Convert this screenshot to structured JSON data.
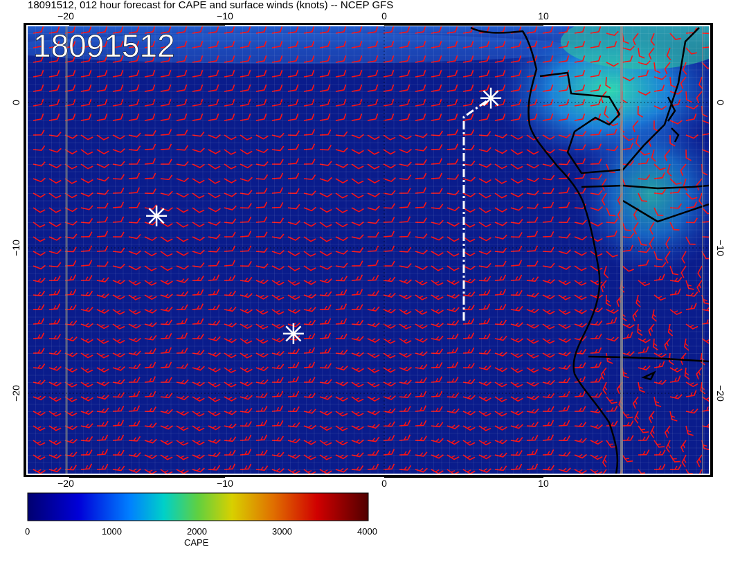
{
  "title": "18091512, 012 hour forecast for CAPE and surface winds (knots) -- NCEP GFS",
  "timestamp_overlay": "18091512",
  "map": {
    "lon_range": [
      -22.5,
      20.5
    ],
    "lat_range": [
      -25.5,
      5
    ],
    "x_tick_labels": [
      {
        "lon": -20,
        "label": "−20"
      },
      {
        "lon": -10,
        "label": "−10"
      },
      {
        "lon": 0,
        "label": "0"
      },
      {
        "lon": 10,
        "label": "10"
      }
    ],
    "y_tick_labels": [
      {
        "lat": 0,
        "label": "0"
      },
      {
        "lat": -10,
        "label": "−10"
      },
      {
        "lat": -20,
        "label": "−20"
      }
    ],
    "markers": [
      {
        "name": "storm-marker-1",
        "lon": 6.7,
        "lat": 0.3
      },
      {
        "name": "storm-marker-2",
        "lon": -14.3,
        "lat": -7.8
      },
      {
        "name": "storm-marker-3",
        "lon": -5.7,
        "lat": -15.9
      }
    ],
    "track": [
      {
        "lon": 5,
        "lat": -15
      },
      {
        "lon": 5,
        "lat": -1
      },
      {
        "lon": 6.7,
        "lat": 0.3
      }
    ],
    "colors": {
      "ocean": "#0a1c8c",
      "wind_barb": "#ff1010",
      "coast": "#000000",
      "marker": "#ffffff"
    }
  },
  "colorbar": {
    "label": "CAPE",
    "ticks": [
      "0",
      "1000",
      "2000",
      "3000",
      "4000"
    ],
    "min": 0,
    "max": 4000
  }
}
